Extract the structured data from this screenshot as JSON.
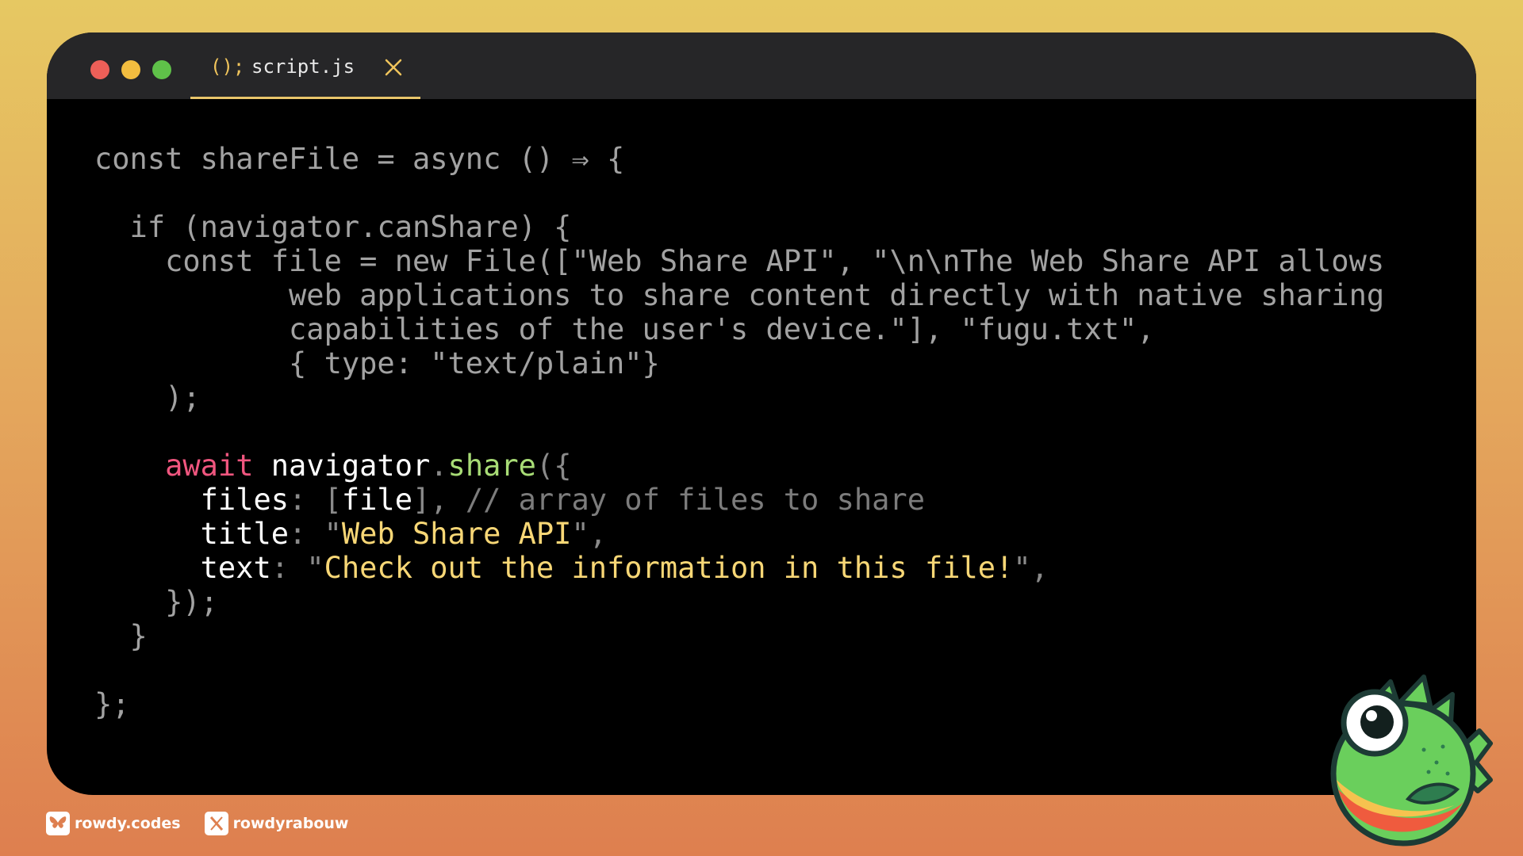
{
  "editor": {
    "tab": {
      "icon_text": "();",
      "filename": "script.js"
    },
    "code_lines": [
      [
        [
          "const shareFile = async () ⇒ {",
          "plain"
        ]
      ],
      [],
      [
        [
          "  if (navigator.canShare) {",
          "plain"
        ]
      ],
      [
        [
          "    const file = new File([\"Web Share API\", \"\\n\\nThe Web Share API allows",
          "plain"
        ]
      ],
      [
        [
          "           web applications to share content directly with native sharing",
          "plain"
        ]
      ],
      [
        [
          "           capabilities of the user's device.\"], \"fugu.txt\",",
          "plain"
        ]
      ],
      [
        [
          "           { type: \"text/plain\"}",
          "plain"
        ]
      ],
      [
        [
          "    );",
          "plain"
        ]
      ],
      [],
      [
        [
          "    ",
          "plain"
        ],
        [
          "await",
          "kw"
        ],
        [
          " ",
          "plain"
        ],
        [
          "navigator",
          "id"
        ],
        [
          ".",
          "pun"
        ],
        [
          "share",
          "fn"
        ],
        [
          "({",
          "pun"
        ]
      ],
      [
        [
          "      ",
          "plain"
        ],
        [
          "files",
          "id"
        ],
        [
          ": [",
          "pun"
        ],
        [
          "file",
          "id"
        ],
        [
          "], ",
          "pun"
        ],
        [
          "// array of files to share",
          "cm"
        ]
      ],
      [
        [
          "      ",
          "plain"
        ],
        [
          "title",
          "id"
        ],
        [
          ": \"",
          "pun"
        ],
        [
          "Web Share API",
          "str"
        ],
        [
          "\",",
          "pun"
        ]
      ],
      [
        [
          "      ",
          "plain"
        ],
        [
          "text",
          "id"
        ],
        [
          ": \"",
          "pun"
        ],
        [
          "Check out the information in this file!",
          "str"
        ],
        [
          "\",",
          "pun"
        ]
      ],
      [
        [
          "    });",
          "plain"
        ]
      ],
      [
        [
          "  }",
          "plain"
        ]
      ],
      [],
      [
        [
          "};",
          "plain"
        ]
      ]
    ]
  },
  "footer": {
    "bluesky_handle": "rowdy.codes",
    "x_handle": "rowdyrabouw"
  },
  "colors": {
    "keyword": "#f0567f",
    "function": "#a8dc76",
    "identifier": "#ffffff",
    "string": "#f8d776",
    "comment": "#7c7c7c",
    "plain": "#a2a2a2",
    "tab_underline": "#e8c56b"
  },
  "icons": [
    "close-icon",
    "bluesky-icon",
    "x-logo-icon",
    "pufferfish-mascot"
  ]
}
